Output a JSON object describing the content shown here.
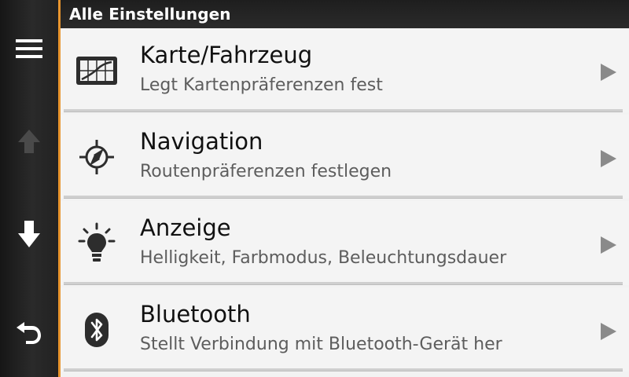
{
  "header": {
    "title": "Alle Einstellungen"
  },
  "sidebar": {
    "buttons": [
      {
        "name": "menu-icon"
      },
      {
        "name": "arrow-up-icon",
        "enabled": false
      },
      {
        "name": "arrow-down-icon",
        "enabled": true
      },
      {
        "name": "back-icon"
      }
    ]
  },
  "settings": {
    "items": [
      {
        "title": "Karte/Fahrzeug",
        "subtitle": "Legt Kartenpräferenzen fest",
        "icon": "map-icon"
      },
      {
        "title": "Navigation",
        "subtitle": "Routenpräferenzen festlegen",
        "icon": "compass-icon"
      },
      {
        "title": "Anzeige",
        "subtitle": "Helligkeit, Farbmodus, Beleuchtungsdauer",
        "icon": "lightbulb-icon"
      },
      {
        "title": "Bluetooth",
        "subtitle": "Stellt Verbindung mit Bluetooth-Gerät her",
        "icon": "bluetooth-icon"
      }
    ]
  },
  "colors": {
    "accent": "#e8952e",
    "sidebar": "#222222",
    "list_background": "#f4f4f4",
    "arrow": "#8a8a8a"
  }
}
